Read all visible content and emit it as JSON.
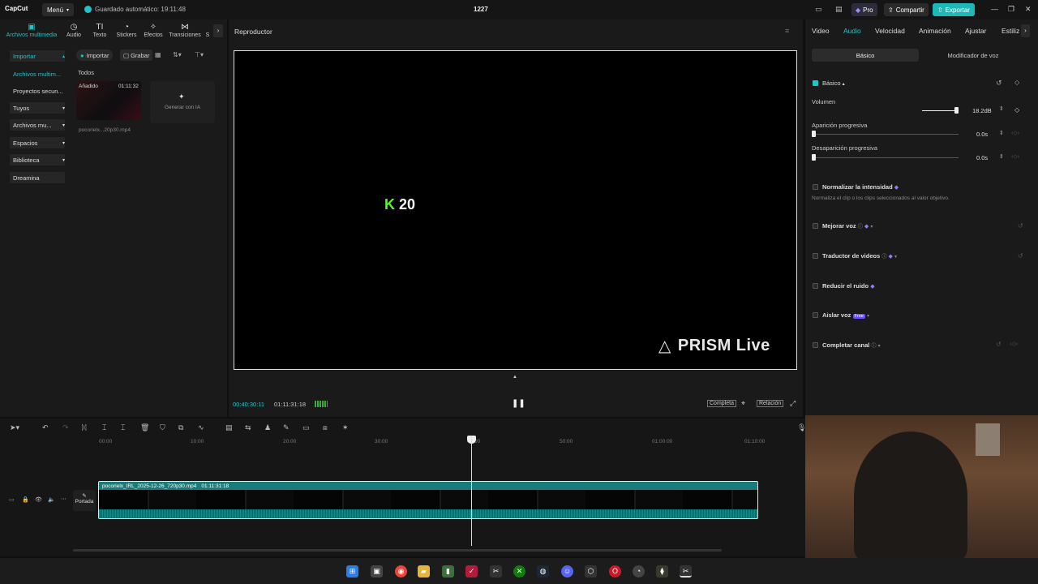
{
  "app": {
    "logo": "CapCut",
    "menu": "Menú",
    "autosave": "Guardado automático: 19:11:48",
    "project": "1227"
  },
  "topbar": {
    "pro": "Pro",
    "share": "Compartir",
    "export": "Exportar"
  },
  "left": {
    "tabs": [
      "Archivos multimedia",
      "Audio",
      "Texto",
      "Stickers",
      "Efectos",
      "Transiciones",
      "S"
    ],
    "sidebar": [
      "Importar",
      "Archivos multim...",
      "Proyectos secun...",
      "Tuyos",
      "Archivos mu...",
      "Espacios",
      "Biblioteca",
      "Dreamina"
    ],
    "import_btn": "Importar",
    "record_btn": "Grabar",
    "filter": "Todos",
    "media": {
      "added": "Añadido",
      "duration": "01:11:32",
      "filename": "pocorielx...20p30.mp4"
    },
    "generate": "Generar con IA"
  },
  "player": {
    "title": "Reproductor",
    "overlay_number": "20",
    "overlay_logo": "PRISM Live",
    "time_current": "00:40:30:11",
    "time_total": "01:11:31:18",
    "btn_complete": "Completa",
    "btn_ratio": "Relación"
  },
  "right": {
    "tabs": [
      "Video",
      "Audio",
      "Velocidad",
      "Animación",
      "Ajustar",
      "Estiliz"
    ],
    "subtabs": [
      "Básico",
      "Modificador de voz"
    ],
    "section": "Básico",
    "volume_label": "Volumen",
    "volume_value": "18.2dB",
    "volume_level": 0.95,
    "fadein_label": "Aparición progresiva",
    "fadein_value": "0.0s",
    "fadeout_label": "Desaparición progresiva",
    "fadeout_value": "0.0s",
    "normalize_label": "Normalizar la intensidad",
    "normalize_desc": "Normaliza el clip o los clips seleccionados al valor objetivo.",
    "enhance_label": "Mejorar voz",
    "translator_label": "Traductor de videos",
    "noise_label": "Reducir el ruido",
    "isolate_label": "Aislar voz",
    "isolate_badge": "Free",
    "fill_label": "Completar canal"
  },
  "timeline": {
    "ruler": [
      "00:00",
      "10:00",
      "20:00",
      "30:00",
      "40:00",
      "50:00",
      "01:00:00",
      "01:10:00"
    ],
    "cover": "Portada",
    "clip_name": "pocorielx_IRL_2025-12-26_720p30.mp4",
    "clip_duration": "01:11:31:18"
  },
  "colors": {
    "accent": "#22c3c8",
    "kick": "#53fc18",
    "clip": "#197c7a"
  }
}
